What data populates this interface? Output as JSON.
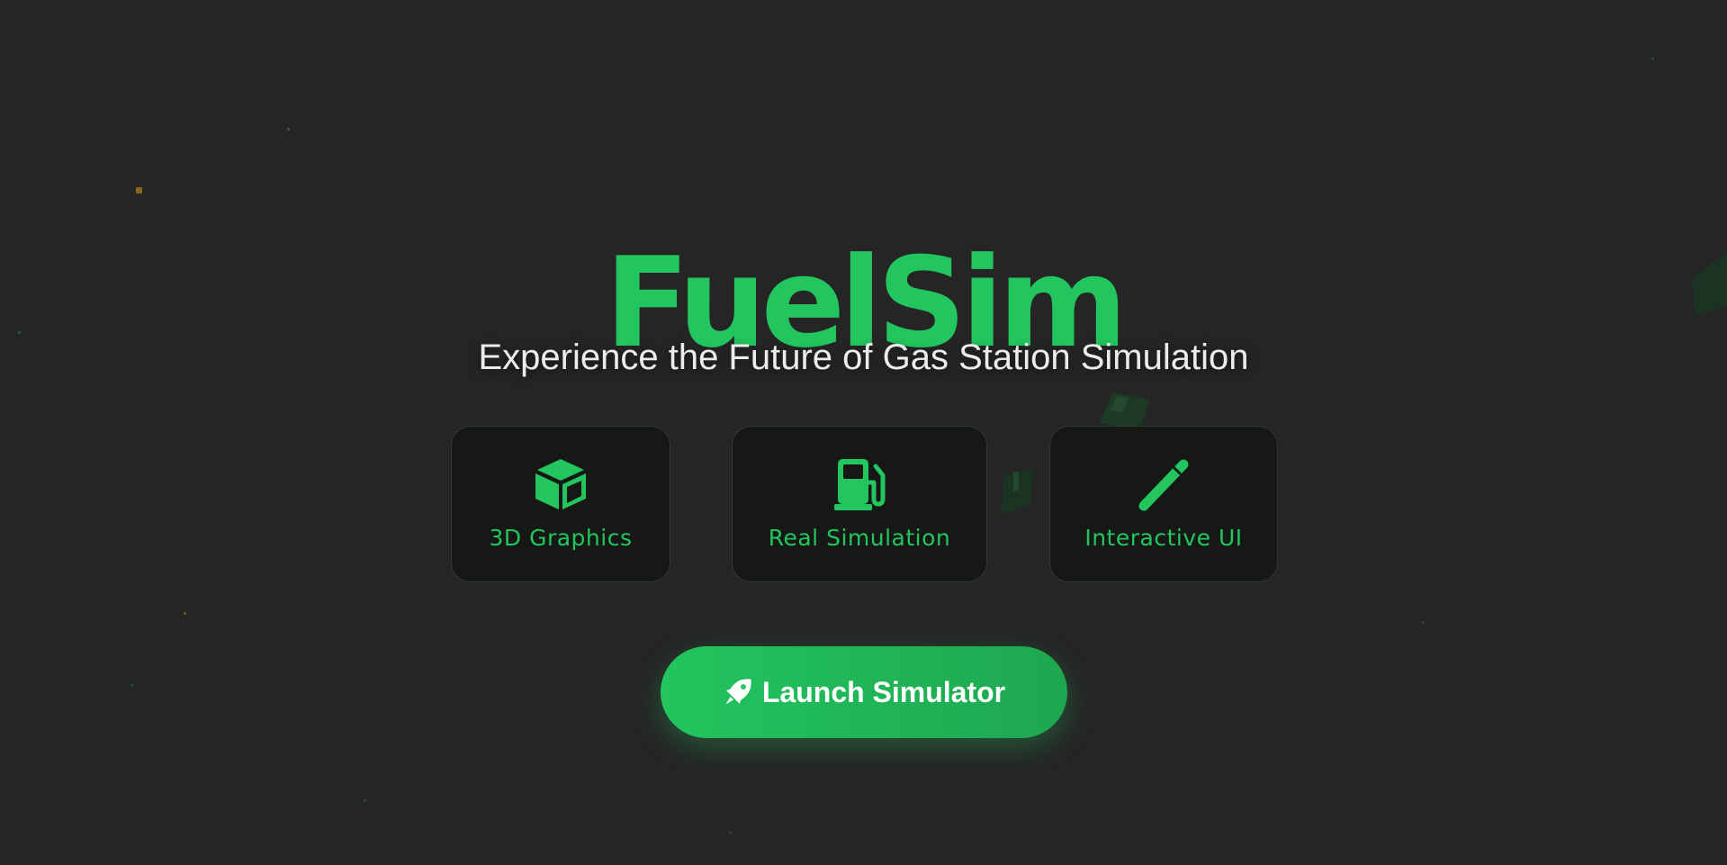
{
  "hero": {
    "title": "FuelSim",
    "subtitle": "Experience the Future of Gas Station Simulation"
  },
  "features": [
    {
      "icon": "cube-icon",
      "label": "3D Graphics"
    },
    {
      "icon": "gas-pump-icon",
      "label": "Real Simulation"
    },
    {
      "icon": "pen-icon",
      "label": "Interactive UI"
    }
  ],
  "cta": {
    "icon": "rocket-icon",
    "label": "Launch Simulator"
  },
  "colors": {
    "background": "#252525",
    "accent": "#22c55e",
    "card_background": "#161816",
    "text_light": "#ececec"
  }
}
